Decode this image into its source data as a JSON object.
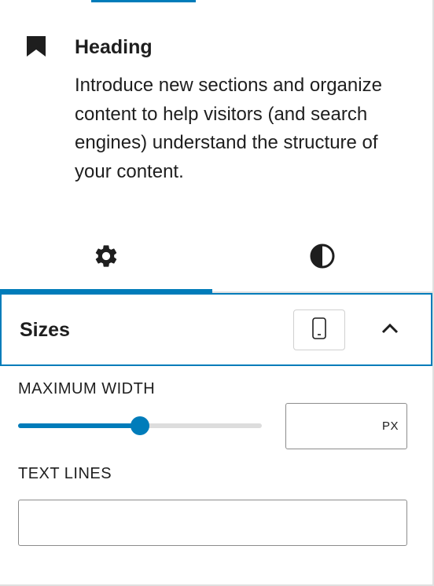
{
  "block": {
    "icon": "bookmark-icon",
    "title": "Heading",
    "description": "Introduce new sections and organize content to help visitors (and search engines) understand the structure of your content."
  },
  "tabs": [
    {
      "icon": "gear-icon",
      "active": true
    },
    {
      "icon": "half-circle-contrast-icon",
      "active": false
    }
  ],
  "sizes_panel": {
    "title": "Sizes",
    "device_icon": "mobile-device-icon",
    "toggle_icon": "chevron-up-icon",
    "expanded": true
  },
  "max_width": {
    "label": "MAXIMUM WIDTH",
    "slider_fraction": 0.5,
    "value": "",
    "unit": "PX"
  },
  "text_lines": {
    "label": "TEXT LINES",
    "value": ""
  },
  "colors": {
    "accent": "#007cba",
    "text": "#1e1e1e",
    "border": "#8c8c8c",
    "track": "#dddddd"
  }
}
